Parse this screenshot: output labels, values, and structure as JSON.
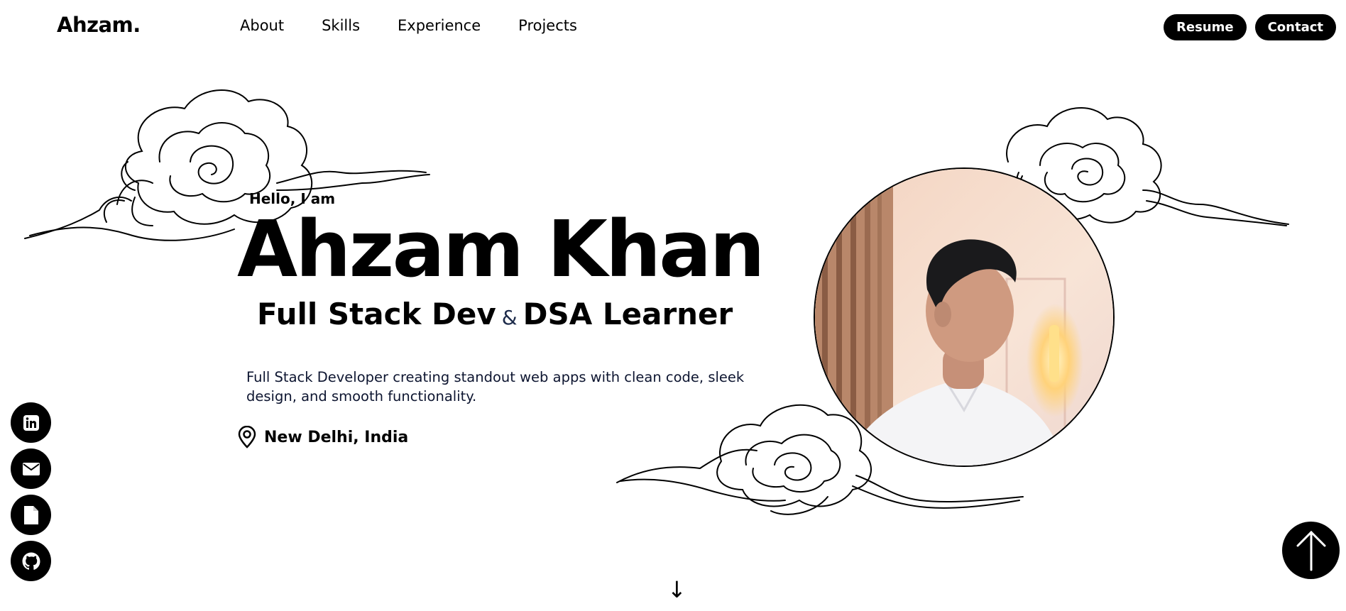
{
  "header": {
    "brand": "Ahzam.",
    "nav": [
      {
        "label": "About"
      },
      {
        "label": "Skills"
      },
      {
        "label": "Experience"
      },
      {
        "label": "Projects"
      }
    ],
    "actions": {
      "resume": "Resume",
      "contact": "Contact"
    }
  },
  "hero": {
    "greeting": "Hello, I am",
    "name": "Ahzam Khan",
    "role_a": "Full Stack Dev",
    "role_amp": "&",
    "role_b": "DSA Learner",
    "description": "Full Stack Developer creating standout web apps with clean code, sleek design, and smooth functionality.",
    "location": "New Delhi, India"
  },
  "icons": {
    "socials": [
      "linkedin-icon",
      "email-icon",
      "document-icon",
      "github-icon"
    ],
    "location": "location-pin-icon",
    "back_to_top": "arrow-up-icon",
    "scroll_down": "↓"
  },
  "colors": {
    "primary": "#000000",
    "background": "#ffffff",
    "text_muted": "#0d1530"
  }
}
